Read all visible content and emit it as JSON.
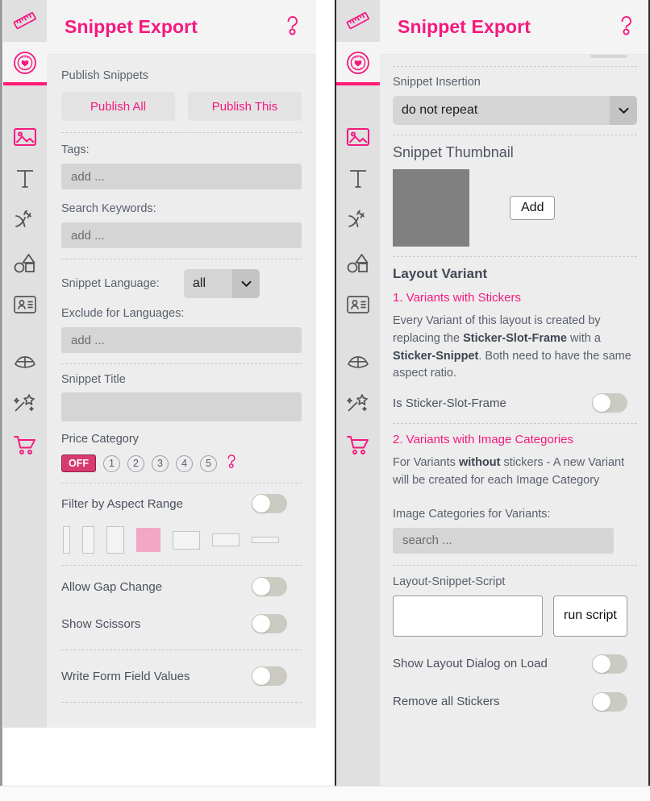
{
  "sidebar": {
    "items": [
      {
        "id": "ruler",
        "icon": "ruler-icon",
        "color": "#f5197f",
        "active": false
      },
      {
        "id": "favorites",
        "icon": "heart-badge-icon",
        "color": "#f5197f",
        "active": true
      },
      {
        "id": "image",
        "icon": "image-icon",
        "color": "#f5197f",
        "active": false
      },
      {
        "id": "text",
        "icon": "text-t-icon",
        "color": "#555555",
        "active": false
      },
      {
        "id": "pen",
        "icon": "pen-curve-icon",
        "color": "#555555",
        "active": false
      },
      {
        "id": "shapes",
        "icon": "shapes-icon",
        "color": "#555555",
        "active": false
      },
      {
        "id": "contact",
        "icon": "contact-card-icon",
        "color": "#555555",
        "active": false
      },
      {
        "id": "perspective",
        "icon": "fan-perspective-icon",
        "color": "#555555",
        "active": false
      },
      {
        "id": "magic",
        "icon": "magic-wand-icon",
        "color": "#555555",
        "active": false
      },
      {
        "id": "cart",
        "icon": "shopping-cart-icon",
        "color": "#f5197f",
        "active": false
      }
    ]
  },
  "left_panel": {
    "header": {
      "title": "Snippet Export",
      "help_icon": "question-mark-icon"
    },
    "publish": {
      "label": "Publish Snippets",
      "publish_all": "Publish All",
      "publish_this": "Publish This"
    },
    "tags": {
      "label": "Tags:",
      "placeholder": "add ...",
      "value": ""
    },
    "search_keywords": {
      "label": "Search Keywords:",
      "placeholder": "add ...",
      "value": ""
    },
    "snippet_language": {
      "label": "Snippet Language:",
      "value": "all",
      "options": [
        "all"
      ]
    },
    "exclude_languages": {
      "label": "Exclude for Languages:",
      "placeholder": "add ...",
      "value": ""
    },
    "snippet_title": {
      "label": "Snippet Title",
      "placeholder": "",
      "value": ""
    },
    "price_category": {
      "label": "Price Category",
      "off_label": "OFF",
      "selected": "OFF",
      "levels": [
        "1",
        "2",
        "3",
        "4",
        "5"
      ],
      "help_icon": "question-mark-icon"
    },
    "filter_aspect_range": {
      "label": "Filter by Aspect Range",
      "enabled": false
    },
    "aspect_shapes": [
      {
        "w": 9,
        "h": 34,
        "selected": false
      },
      {
        "w": 15,
        "h": 34,
        "selected": false
      },
      {
        "w": 22,
        "h": 34,
        "selected": false
      },
      {
        "w": 30,
        "h": 30,
        "selected": true
      },
      {
        "w": 34,
        "h": 23,
        "selected": false
      },
      {
        "w": 34,
        "h": 16,
        "selected": false
      },
      {
        "w": 34,
        "h": 8,
        "selected": false
      }
    ],
    "allow_gap_change": {
      "label": "Allow Gap Change",
      "enabled": false
    },
    "show_scissors": {
      "label": "Show Scissors",
      "enabled": false
    },
    "write_form_field_values": {
      "label": "Write Form Field Values",
      "enabled": false
    }
  },
  "right_panel": {
    "header": {
      "title": "Snippet Export",
      "help_icon": "question-mark-icon"
    },
    "snippet_insertion": {
      "label": "Snippet Insertion",
      "value": "do not repeat",
      "options": [
        "do not repeat"
      ]
    },
    "snippet_thumbnail": {
      "label": "Snippet Thumbnail",
      "add_label": "Add"
    },
    "layout_variant": {
      "title": "Layout Variant",
      "section1": {
        "heading": "1. Variants with Stickers",
        "body_parts": [
          {
            "text": "Every Variant of this layout is created by replacing the ",
            "bold": false
          },
          {
            "text": "Sticker-Slot-Frame",
            "bold": true
          },
          {
            "text": " with a ",
            "bold": false
          },
          {
            "text": "Sticker-Snippet",
            "bold": true
          },
          {
            "text": ". Both need to have the same aspect ratio.",
            "bold": false
          }
        ],
        "toggle": {
          "label": "Is Sticker-Slot-Frame",
          "enabled": false
        }
      },
      "section2": {
        "heading": "2. Variants with Image Categories",
        "body_parts": [
          {
            "text": "For Variants ",
            "bold": false
          },
          {
            "text": "without",
            "bold": true
          },
          {
            "text": " stickers - A new Variant will be created for each Image Category",
            "bold": false
          }
        ],
        "categories": {
          "label": "Image Categories for Variants:",
          "placeholder": "search ...",
          "value": ""
        }
      }
    },
    "layout_snippet_script": {
      "label": "Layout-Snippet-Script",
      "value": "",
      "run_label": "run script"
    },
    "show_layout_dialog_on_load": {
      "label": "Show Layout Dialog on Load",
      "enabled": false
    },
    "remove_all_stickers": {
      "label": "Remove all Stickers",
      "enabled": false
    }
  },
  "colors": {
    "accent": "#f5197f",
    "panel_bg": "#ededee",
    "sidebar_bg": "#e0e0e0",
    "header_bg": "#f4f4f4",
    "text": "#5a616d",
    "field_bg": "#d5d5d5",
    "toggle_off": "#cbcbc2",
    "thumb_placeholder": "#808080"
  }
}
